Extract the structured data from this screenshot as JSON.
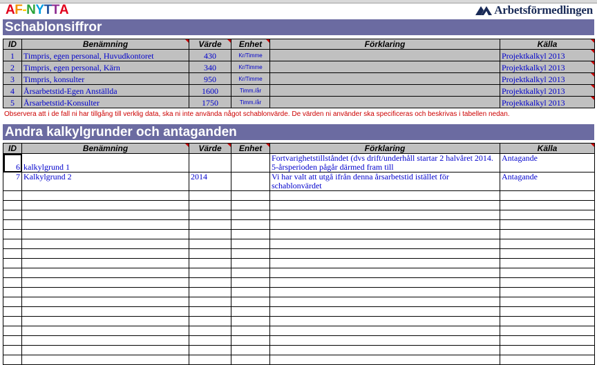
{
  "logos": {
    "left_text": "AF-NYTTA",
    "left_colors": [
      "#e2001a",
      "#f39200",
      "#ffcc00",
      "#2aa33b",
      "#009fe3",
      "#1d4f9c",
      "#8e2c91",
      "#e2001a"
    ],
    "right_text": "Arbetsförmedlingen",
    "brand_color": "#1a2b57"
  },
  "section1": {
    "title": "Schablonsiffror",
    "headers": [
      "ID",
      "Benämning",
      "Värde",
      "Enhet",
      "Förklaring",
      "Källa"
    ],
    "rows": [
      {
        "id": "1",
        "name": "Timpris, egen personal, Huvudkontoret",
        "value": "430",
        "unit": "Kr/Timme",
        "desc": "",
        "source": "Projektkalkyl 2013"
      },
      {
        "id": "2",
        "name": "Timpris, egen personal, Kärn",
        "value": "340",
        "unit": "Kr/Timme",
        "desc": "",
        "source": "Projektkalkyl 2013"
      },
      {
        "id": "3",
        "name": "Timpris, konsulter",
        "value": "950",
        "unit": "Kr/Timme",
        "desc": "",
        "source": "Projektkalkyl 2013"
      },
      {
        "id": "4",
        "name": "Årsarbetstid-Egen Anställda",
        "value": "1600",
        "unit": "Timm./år",
        "desc": "",
        "source": "Projektkalkyl 2013"
      },
      {
        "id": "5",
        "name": "Årsarbetstid-Konsulter",
        "value": "1750",
        "unit": "Timm./år",
        "desc": "",
        "source": "Projektkalkyl 2013"
      }
    ],
    "note": "Observera att i de fall ni har tillgång till verklig data, ska ni inte använda något schablonvärde. De värden ni använder ska specificeras och beskrivas i tabellen nedan."
  },
  "section2": {
    "title": "Andra kalkylgrunder och antaganden",
    "headers": [
      "ID",
      "Benämning",
      "Värde",
      "Enhet",
      "Förklaring",
      "Källa"
    ],
    "rows": [
      {
        "id": "6",
        "name": "kalkylgrund 1",
        "value": "",
        "unit": "",
        "desc": "Fortvarighetstillståndet (dvs drift/underhåll startar 2 halvåret 2014. 5-årsperioden pågår därmed fram till",
        "source": "Antagande"
      },
      {
        "id": "7",
        "name": "Kalkylgrund 2",
        "value": "2014",
        "unit": "",
        "desc": "Vi har valt att utgå ifrån denna årsarbetstid istället för schablonvärdet",
        "source": "Antagande"
      }
    ]
  }
}
